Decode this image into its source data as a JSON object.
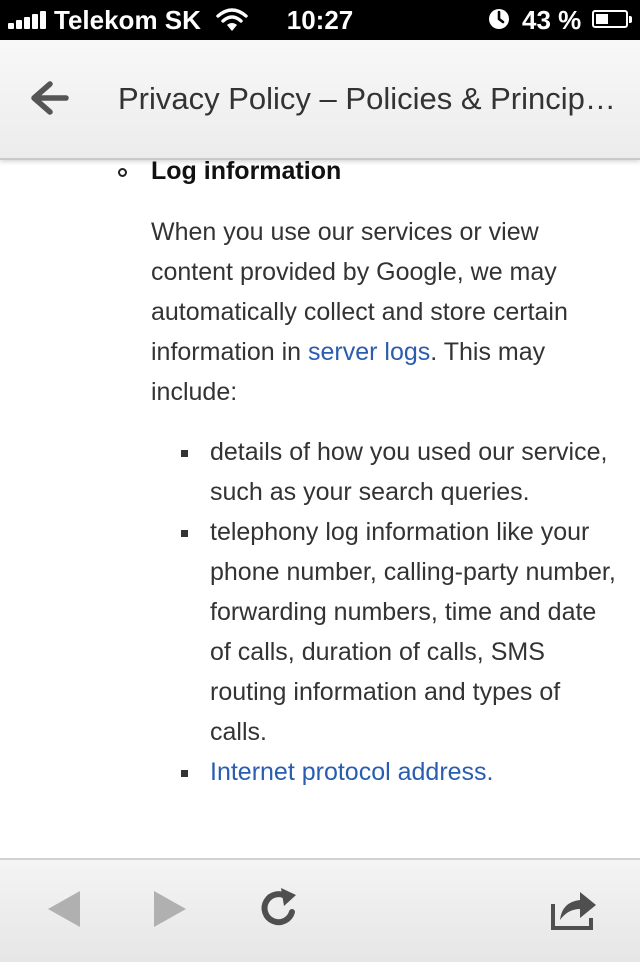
{
  "status_bar": {
    "carrier": "Telekom SK",
    "time": "10:27",
    "battery_text": "43 %",
    "battery_level": 0.43
  },
  "header": {
    "title": "Privacy Policy – Policies & Principl…",
    "back_icon": "back-arrow-icon"
  },
  "content": {
    "heading": "Log information",
    "intro_before_link": "When you use our services or view content provided by Google, we may automatically collect and store certain information in ",
    "intro_link": "server logs",
    "intro_after_link": ". This may include:",
    "items": [
      {
        "text": "details of how you used our service, such as your search queries."
      },
      {
        "text": "telephony log information like your phone number, calling-party number, forwarding numbers, time and date of calls, duration of calls, SMS routing information and types of calls."
      },
      {
        "text": "Internet protocol address."
      }
    ]
  },
  "toolbar": {
    "icons": [
      "back-icon",
      "forward-icon",
      "reload-icon",
      "share-icon"
    ]
  },
  "colors": {
    "link": "#2a5db0",
    "text": "#333333",
    "toolbar_icon": "#8a8a8a",
    "status_bar_bg": "#000000"
  }
}
